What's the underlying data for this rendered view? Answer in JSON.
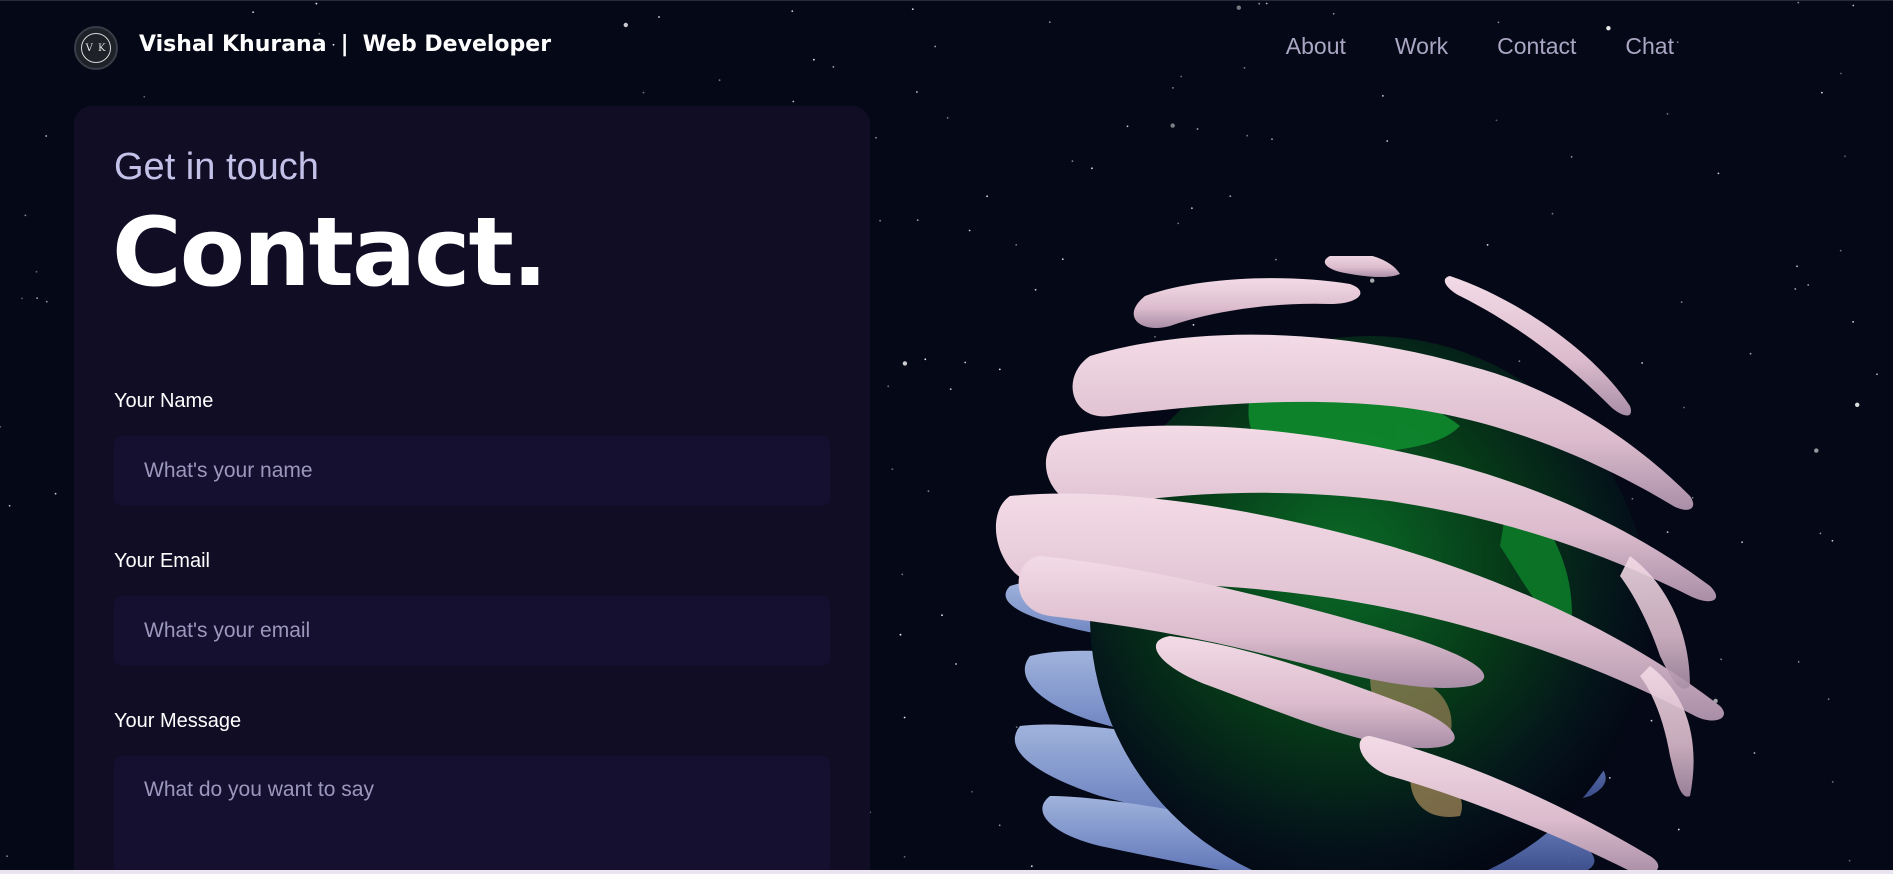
{
  "header": {
    "logo_initials": "V K",
    "brand_name": "Vishal Khurana",
    "brand_separator": "|",
    "brand_role": "Web Developer"
  },
  "nav": {
    "links": [
      {
        "label": "About"
      },
      {
        "label": "Work"
      },
      {
        "label": "Contact"
      },
      {
        "label": "Chat"
      }
    ]
  },
  "contact": {
    "subtitle": "Get in touch",
    "title": "Contact.",
    "name": {
      "label": "Your Name",
      "placeholder": "What's your name",
      "value": ""
    },
    "email": {
      "label": "Your Email",
      "placeholder": "What's your email",
      "value": ""
    },
    "message": {
      "label": "Your Message",
      "placeholder": "What do you want to say",
      "value": ""
    }
  },
  "colors": {
    "background": "#050816",
    "card": "#100d25",
    "input": "#151030",
    "nav_text": "#aaa6c3",
    "subtitle": "#c4c1e8",
    "globe_band": "#e3c4d4",
    "globe_land": "#0d7a2a"
  },
  "scene": {
    "object": "earth-globe-with-swirl-bands-3d",
    "background": "starfield"
  }
}
